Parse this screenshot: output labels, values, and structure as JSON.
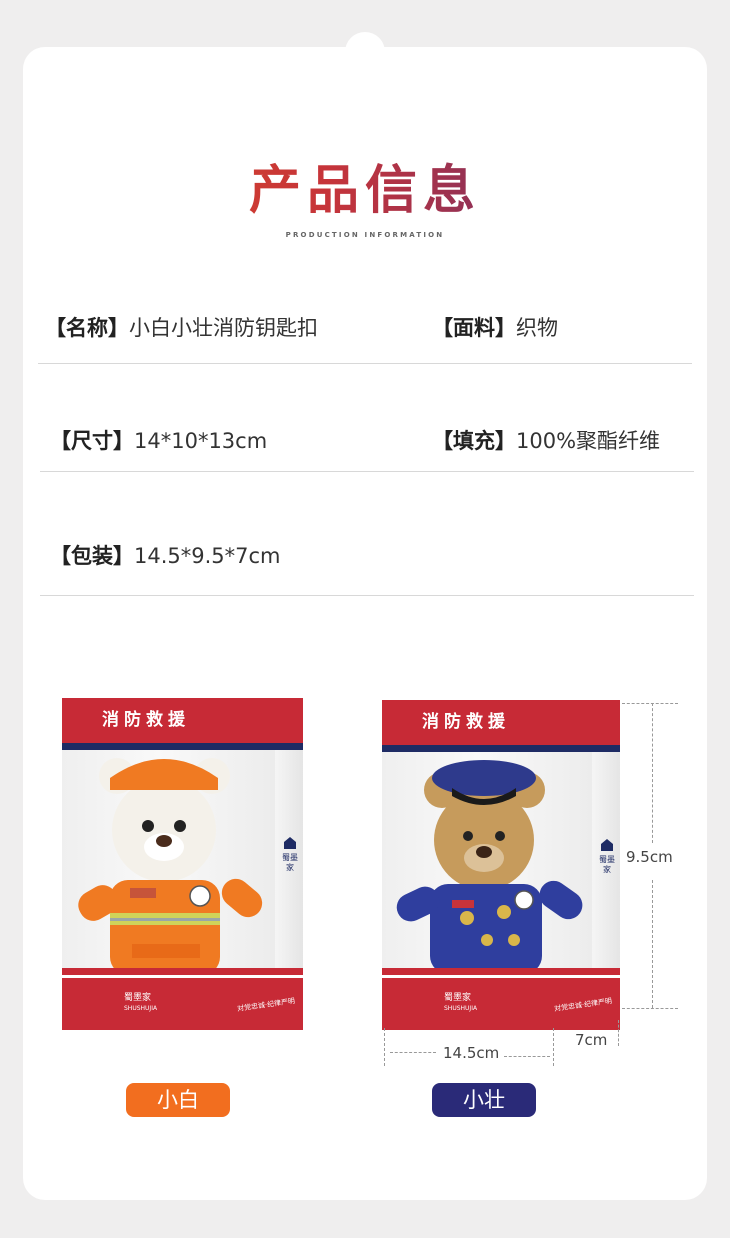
{
  "title": "产品信息",
  "subtitle": "PRODUCTION INFORMATION",
  "specs": {
    "name_label": "【名称】",
    "name_value": "小白小壮消防钥匙扣",
    "material_label": "【面料】",
    "material_value": "织物",
    "size_label": "【尺寸】",
    "size_value": "14*10*13cm",
    "filling_label": "【填充】",
    "filling_value": "100%聚酯纤维",
    "package_label": "【包装】",
    "package_value": "14.5*9.5*7cm"
  },
  "products": [
    {
      "box_title": "消防救援",
      "name": "小白",
      "color": "#f26e1f",
      "bear_color": "#f4f1ea",
      "uniform_color": "#f07a22"
    },
    {
      "box_title": "消防救援",
      "name": "小壮",
      "color": "#2a2a78",
      "bear_color": "#c69b5c",
      "uniform_color": "#2f3e9e"
    }
  ],
  "brand": {
    "cn": "蜀墨家",
    "en": "SHUSHUJIA"
  },
  "slogan": "对党忠诚·纪律严明",
  "dimensions": {
    "height": "9.5cm",
    "width": "14.5cm",
    "depth": "7cm"
  },
  "colors": {
    "box_red": "#c72a36",
    "navy": "#1e2b64"
  }
}
